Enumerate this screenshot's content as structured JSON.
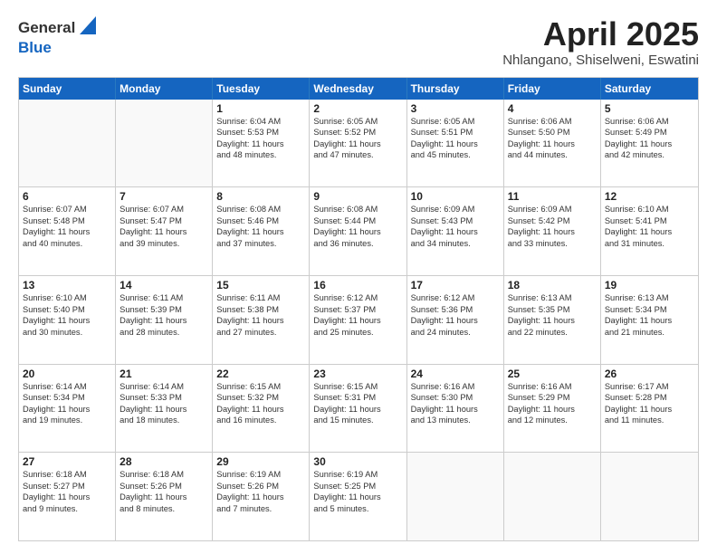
{
  "logo": {
    "general": "General",
    "blue": "Blue"
  },
  "title": {
    "month": "April 2025",
    "location": "Nhlangano, Shiselweni, Eswatini"
  },
  "calendar": {
    "headers": [
      "Sunday",
      "Monday",
      "Tuesday",
      "Wednesday",
      "Thursday",
      "Friday",
      "Saturday"
    ],
    "rows": [
      [
        {
          "day": "",
          "empty": true
        },
        {
          "day": "",
          "empty": true
        },
        {
          "day": "1",
          "lines": [
            "Sunrise: 6:04 AM",
            "Sunset: 5:53 PM",
            "Daylight: 11 hours",
            "and 48 minutes."
          ]
        },
        {
          "day": "2",
          "lines": [
            "Sunrise: 6:05 AM",
            "Sunset: 5:52 PM",
            "Daylight: 11 hours",
            "and 47 minutes."
          ]
        },
        {
          "day": "3",
          "lines": [
            "Sunrise: 6:05 AM",
            "Sunset: 5:51 PM",
            "Daylight: 11 hours",
            "and 45 minutes."
          ]
        },
        {
          "day": "4",
          "lines": [
            "Sunrise: 6:06 AM",
            "Sunset: 5:50 PM",
            "Daylight: 11 hours",
            "and 44 minutes."
          ]
        },
        {
          "day": "5",
          "lines": [
            "Sunrise: 6:06 AM",
            "Sunset: 5:49 PM",
            "Daylight: 11 hours",
            "and 42 minutes."
          ]
        }
      ],
      [
        {
          "day": "6",
          "lines": [
            "Sunrise: 6:07 AM",
            "Sunset: 5:48 PM",
            "Daylight: 11 hours",
            "and 40 minutes."
          ]
        },
        {
          "day": "7",
          "lines": [
            "Sunrise: 6:07 AM",
            "Sunset: 5:47 PM",
            "Daylight: 11 hours",
            "and 39 minutes."
          ]
        },
        {
          "day": "8",
          "lines": [
            "Sunrise: 6:08 AM",
            "Sunset: 5:46 PM",
            "Daylight: 11 hours",
            "and 37 minutes."
          ]
        },
        {
          "day": "9",
          "lines": [
            "Sunrise: 6:08 AM",
            "Sunset: 5:44 PM",
            "Daylight: 11 hours",
            "and 36 minutes."
          ]
        },
        {
          "day": "10",
          "lines": [
            "Sunrise: 6:09 AM",
            "Sunset: 5:43 PM",
            "Daylight: 11 hours",
            "and 34 minutes."
          ]
        },
        {
          "day": "11",
          "lines": [
            "Sunrise: 6:09 AM",
            "Sunset: 5:42 PM",
            "Daylight: 11 hours",
            "and 33 minutes."
          ]
        },
        {
          "day": "12",
          "lines": [
            "Sunrise: 6:10 AM",
            "Sunset: 5:41 PM",
            "Daylight: 11 hours",
            "and 31 minutes."
          ]
        }
      ],
      [
        {
          "day": "13",
          "lines": [
            "Sunrise: 6:10 AM",
            "Sunset: 5:40 PM",
            "Daylight: 11 hours",
            "and 30 minutes."
          ]
        },
        {
          "day": "14",
          "lines": [
            "Sunrise: 6:11 AM",
            "Sunset: 5:39 PM",
            "Daylight: 11 hours",
            "and 28 minutes."
          ]
        },
        {
          "day": "15",
          "lines": [
            "Sunrise: 6:11 AM",
            "Sunset: 5:38 PM",
            "Daylight: 11 hours",
            "and 27 minutes."
          ]
        },
        {
          "day": "16",
          "lines": [
            "Sunrise: 6:12 AM",
            "Sunset: 5:37 PM",
            "Daylight: 11 hours",
            "and 25 minutes."
          ]
        },
        {
          "day": "17",
          "lines": [
            "Sunrise: 6:12 AM",
            "Sunset: 5:36 PM",
            "Daylight: 11 hours",
            "and 24 minutes."
          ]
        },
        {
          "day": "18",
          "lines": [
            "Sunrise: 6:13 AM",
            "Sunset: 5:35 PM",
            "Daylight: 11 hours",
            "and 22 minutes."
          ]
        },
        {
          "day": "19",
          "lines": [
            "Sunrise: 6:13 AM",
            "Sunset: 5:34 PM",
            "Daylight: 11 hours",
            "and 21 minutes."
          ]
        }
      ],
      [
        {
          "day": "20",
          "lines": [
            "Sunrise: 6:14 AM",
            "Sunset: 5:34 PM",
            "Daylight: 11 hours",
            "and 19 minutes."
          ]
        },
        {
          "day": "21",
          "lines": [
            "Sunrise: 6:14 AM",
            "Sunset: 5:33 PM",
            "Daylight: 11 hours",
            "and 18 minutes."
          ]
        },
        {
          "day": "22",
          "lines": [
            "Sunrise: 6:15 AM",
            "Sunset: 5:32 PM",
            "Daylight: 11 hours",
            "and 16 minutes."
          ]
        },
        {
          "day": "23",
          "lines": [
            "Sunrise: 6:15 AM",
            "Sunset: 5:31 PM",
            "Daylight: 11 hours",
            "and 15 minutes."
          ]
        },
        {
          "day": "24",
          "lines": [
            "Sunrise: 6:16 AM",
            "Sunset: 5:30 PM",
            "Daylight: 11 hours",
            "and 13 minutes."
          ]
        },
        {
          "day": "25",
          "lines": [
            "Sunrise: 6:16 AM",
            "Sunset: 5:29 PM",
            "Daylight: 11 hours",
            "and 12 minutes."
          ]
        },
        {
          "day": "26",
          "lines": [
            "Sunrise: 6:17 AM",
            "Sunset: 5:28 PM",
            "Daylight: 11 hours",
            "and 11 minutes."
          ]
        }
      ],
      [
        {
          "day": "27",
          "lines": [
            "Sunrise: 6:18 AM",
            "Sunset: 5:27 PM",
            "Daylight: 11 hours",
            "and 9 minutes."
          ]
        },
        {
          "day": "28",
          "lines": [
            "Sunrise: 6:18 AM",
            "Sunset: 5:26 PM",
            "Daylight: 11 hours",
            "and 8 minutes."
          ]
        },
        {
          "day": "29",
          "lines": [
            "Sunrise: 6:19 AM",
            "Sunset: 5:26 PM",
            "Daylight: 11 hours",
            "and 7 minutes."
          ]
        },
        {
          "day": "30",
          "lines": [
            "Sunrise: 6:19 AM",
            "Sunset: 5:25 PM",
            "Daylight: 11 hours",
            "and 5 minutes."
          ]
        },
        {
          "day": "",
          "empty": true
        },
        {
          "day": "",
          "empty": true
        },
        {
          "day": "",
          "empty": true
        }
      ]
    ]
  }
}
